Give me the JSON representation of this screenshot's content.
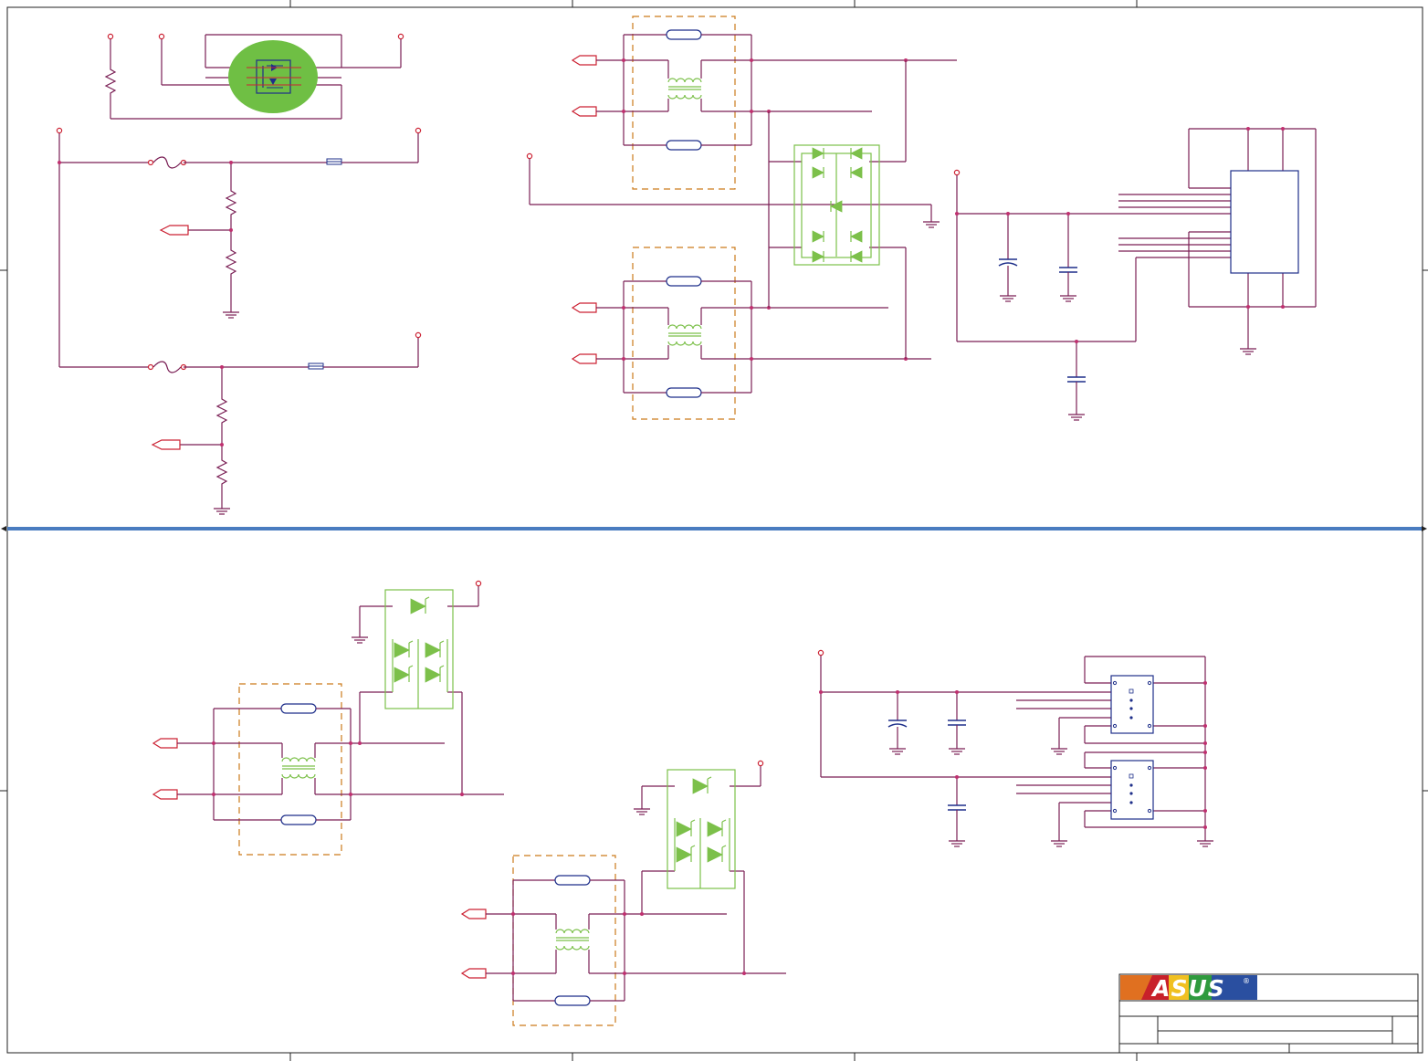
{
  "title_block": {
    "logo_text": "ASUS",
    "logo_mark": "®"
  },
  "colors": {
    "wire": "#7a1f55",
    "port": "#cc2233",
    "esd_protection": "#7cc04a",
    "common_mode_choke": "#cc7a1a",
    "ic_outline": "#1e2f8a",
    "highlight": "#6fbf44",
    "divider": "#4a7cc0"
  },
  "icons": [
    "power-port-icon",
    "ground-icon",
    "resistor-icon",
    "capacitor-icon",
    "fuse-icon",
    "ferrite-bead-icon",
    "diode-icon",
    "mosfet-icon",
    "common-mode-choke-icon",
    "esd-array-icon",
    "usb-connector-icon",
    "offpage-connector-icon"
  ]
}
